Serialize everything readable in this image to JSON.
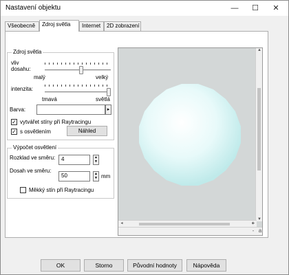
{
  "window": {
    "title": "Nastavení objektu"
  },
  "titlebar_buttons": {
    "minimize": "—",
    "maximize": "☐",
    "close": "✕"
  },
  "tabs": [
    {
      "label": "Všeobecně"
    },
    {
      "label": "Zdroj světla"
    },
    {
      "label": "Internet"
    },
    {
      "label": "2D zobrazení"
    }
  ],
  "light_source": {
    "legend": "Zdroj světla",
    "influence": {
      "label_line1": "vliv",
      "label_line2": "dosahu:",
      "min_label": "malý",
      "max_label": "velký",
      "value": 0.55
    },
    "intensity": {
      "label": "intenzita:",
      "min_label": "tmavá",
      "max_label": "světlá",
      "value": 1.0
    },
    "color": {
      "label": "Barva:",
      "value": "",
      "arrow": "▸"
    },
    "cast_shadows": {
      "label": "vytvářet stíny při Raytracingu",
      "checked": true
    },
    "with_lighting": {
      "label": "s osvětlením",
      "checked": true
    },
    "preview_button": "Náhled"
  },
  "lighting_calc": {
    "legend": "Výpočet osvětlení",
    "distribution": {
      "label": "Rozklad ve směru:",
      "value": "4"
    },
    "range": {
      "label": "Dosah ve směru:",
      "value": "50",
      "unit": "mm"
    },
    "soft_shadow": {
      "label": "Měkký stín při Raytracingu",
      "checked": false
    }
  },
  "preview": {
    "sphere_color": "#e3f8f8",
    "background_color": "#d3d7d7",
    "zoom_plus": "+",
    "zoom_minus": "-",
    "zoom_label": "a"
  },
  "buttons": {
    "ok": "OK",
    "cancel": "Storno",
    "reset": "Původní hodnoty",
    "help": "Nápověda"
  }
}
